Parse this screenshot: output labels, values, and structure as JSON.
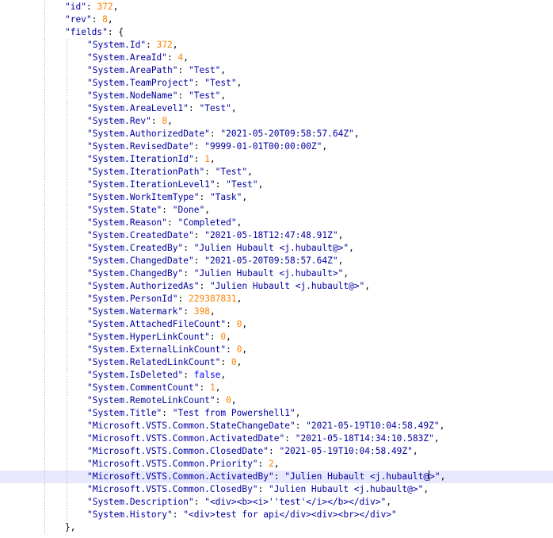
{
  "editor": {
    "active_line": 37,
    "caret_after": "Julien Hubault <j.hubault@",
    "colors": {
      "key_string": "#0000a0",
      "number": "#ff8000",
      "boolean": "#0000ff",
      "punctuation": "#000000",
      "active_line_bg": "#e8e8ff",
      "indent_guide": "#c8c8c8"
    },
    "lines": [
      {
        "indent": 0,
        "tokens": [
          {
            "t": "k",
            "v": "\"id\""
          },
          {
            "t": "p",
            "v": ": "
          },
          {
            "t": "n",
            "v": "372"
          },
          {
            "t": "p",
            "v": ","
          }
        ]
      },
      {
        "indent": 0,
        "tokens": [
          {
            "t": "k",
            "v": "\"rev\""
          },
          {
            "t": "p",
            "v": ": "
          },
          {
            "t": "n",
            "v": "8"
          },
          {
            "t": "p",
            "v": ","
          }
        ]
      },
      {
        "indent": 0,
        "tokens": [
          {
            "t": "k",
            "v": "\"fields\""
          },
          {
            "t": "p",
            "v": ": {"
          }
        ]
      },
      {
        "indent": 1,
        "tokens": [
          {
            "t": "k",
            "v": "\"System.Id\""
          },
          {
            "t": "p",
            "v": ": "
          },
          {
            "t": "n",
            "v": "372"
          },
          {
            "t": "p",
            "v": ","
          }
        ]
      },
      {
        "indent": 1,
        "tokens": [
          {
            "t": "k",
            "v": "\"System.AreaId\""
          },
          {
            "t": "p",
            "v": ": "
          },
          {
            "t": "n",
            "v": "4"
          },
          {
            "t": "p",
            "v": ","
          }
        ]
      },
      {
        "indent": 1,
        "tokens": [
          {
            "t": "k",
            "v": "\"System.AreaPath\""
          },
          {
            "t": "p",
            "v": ": "
          },
          {
            "t": "k",
            "v": "\"Test\""
          },
          {
            "t": "p",
            "v": ","
          }
        ]
      },
      {
        "indent": 1,
        "tokens": [
          {
            "t": "k",
            "v": "\"System.TeamProject\""
          },
          {
            "t": "p",
            "v": ": "
          },
          {
            "t": "k",
            "v": "\"Test\""
          },
          {
            "t": "p",
            "v": ","
          }
        ]
      },
      {
        "indent": 1,
        "tokens": [
          {
            "t": "k",
            "v": "\"System.NodeName\""
          },
          {
            "t": "p",
            "v": ": "
          },
          {
            "t": "k",
            "v": "\"Test\""
          },
          {
            "t": "p",
            "v": ","
          }
        ]
      },
      {
        "indent": 1,
        "tokens": [
          {
            "t": "k",
            "v": "\"System.AreaLevel1\""
          },
          {
            "t": "p",
            "v": ": "
          },
          {
            "t": "k",
            "v": "\"Test\""
          },
          {
            "t": "p",
            "v": ","
          }
        ]
      },
      {
        "indent": 1,
        "tokens": [
          {
            "t": "k",
            "v": "\"System.Rev\""
          },
          {
            "t": "p",
            "v": ": "
          },
          {
            "t": "n",
            "v": "8"
          },
          {
            "t": "p",
            "v": ","
          }
        ]
      },
      {
        "indent": 1,
        "tokens": [
          {
            "t": "k",
            "v": "\"System.AuthorizedDate\""
          },
          {
            "t": "p",
            "v": ": "
          },
          {
            "t": "k",
            "v": "\"2021-05-20T09:58:57.64Z\""
          },
          {
            "t": "p",
            "v": ","
          }
        ]
      },
      {
        "indent": 1,
        "tokens": [
          {
            "t": "k",
            "v": "\"System.RevisedDate\""
          },
          {
            "t": "p",
            "v": ": "
          },
          {
            "t": "k",
            "v": "\"9999-01-01T00:00:00Z\""
          },
          {
            "t": "p",
            "v": ","
          }
        ]
      },
      {
        "indent": 1,
        "tokens": [
          {
            "t": "k",
            "v": "\"System.IterationId\""
          },
          {
            "t": "p",
            "v": ": "
          },
          {
            "t": "n",
            "v": "1"
          },
          {
            "t": "p",
            "v": ","
          }
        ]
      },
      {
        "indent": 1,
        "tokens": [
          {
            "t": "k",
            "v": "\"System.IterationPath\""
          },
          {
            "t": "p",
            "v": ": "
          },
          {
            "t": "k",
            "v": "\"Test\""
          },
          {
            "t": "p",
            "v": ","
          }
        ]
      },
      {
        "indent": 1,
        "tokens": [
          {
            "t": "k",
            "v": "\"System.IterationLevel1\""
          },
          {
            "t": "p",
            "v": ": "
          },
          {
            "t": "k",
            "v": "\"Test\""
          },
          {
            "t": "p",
            "v": ","
          }
        ]
      },
      {
        "indent": 1,
        "tokens": [
          {
            "t": "k",
            "v": "\"System.WorkItemType\""
          },
          {
            "t": "p",
            "v": ": "
          },
          {
            "t": "k",
            "v": "\"Task\""
          },
          {
            "t": "p",
            "v": ","
          }
        ]
      },
      {
        "indent": 1,
        "tokens": [
          {
            "t": "k",
            "v": "\"System.State\""
          },
          {
            "t": "p",
            "v": ": "
          },
          {
            "t": "k",
            "v": "\"Done\""
          },
          {
            "t": "p",
            "v": ","
          }
        ]
      },
      {
        "indent": 1,
        "tokens": [
          {
            "t": "k",
            "v": "\"System.Reason\""
          },
          {
            "t": "p",
            "v": ": "
          },
          {
            "t": "k",
            "v": "\"Completed\""
          },
          {
            "t": "p",
            "v": ","
          }
        ]
      },
      {
        "indent": 1,
        "tokens": [
          {
            "t": "k",
            "v": "\"System.CreatedDate\""
          },
          {
            "t": "p",
            "v": ": "
          },
          {
            "t": "k",
            "v": "\"2021-05-18T12:47:48.91Z\""
          },
          {
            "t": "p",
            "v": ","
          }
        ]
      },
      {
        "indent": 1,
        "tokens": [
          {
            "t": "k",
            "v": "\"System.CreatedBy\""
          },
          {
            "t": "p",
            "v": ": "
          },
          {
            "t": "k",
            "v": "\"Julien Hubault <j.hubault@>\""
          },
          {
            "t": "p",
            "v": ","
          }
        ]
      },
      {
        "indent": 1,
        "tokens": [
          {
            "t": "k",
            "v": "\"System.ChangedDate\""
          },
          {
            "t": "p",
            "v": ": "
          },
          {
            "t": "k",
            "v": "\"2021-05-20T09:58:57.64Z\""
          },
          {
            "t": "p",
            "v": ","
          }
        ]
      },
      {
        "indent": 1,
        "tokens": [
          {
            "t": "k",
            "v": "\"System.ChangedBy\""
          },
          {
            "t": "p",
            "v": ": "
          },
          {
            "t": "k",
            "v": "\"Julien Hubault <j.hubault>\""
          },
          {
            "t": "p",
            "v": ","
          }
        ]
      },
      {
        "indent": 1,
        "tokens": [
          {
            "t": "k",
            "v": "\"System.AuthorizedAs\""
          },
          {
            "t": "p",
            "v": ": "
          },
          {
            "t": "k",
            "v": "\"Julien Hubault <j.hubault@>\""
          },
          {
            "t": "p",
            "v": ","
          }
        ]
      },
      {
        "indent": 1,
        "tokens": [
          {
            "t": "k",
            "v": "\"System.PersonId\""
          },
          {
            "t": "p",
            "v": ": "
          },
          {
            "t": "n",
            "v": "229387831"
          },
          {
            "t": "p",
            "v": ","
          }
        ]
      },
      {
        "indent": 1,
        "tokens": [
          {
            "t": "k",
            "v": "\"System.Watermark\""
          },
          {
            "t": "p",
            "v": ": "
          },
          {
            "t": "n",
            "v": "398"
          },
          {
            "t": "p",
            "v": ","
          }
        ]
      },
      {
        "indent": 1,
        "tokens": [
          {
            "t": "k",
            "v": "\"System.AttachedFileCount\""
          },
          {
            "t": "p",
            "v": ": "
          },
          {
            "t": "n",
            "v": "0"
          },
          {
            "t": "p",
            "v": ","
          }
        ]
      },
      {
        "indent": 1,
        "tokens": [
          {
            "t": "k",
            "v": "\"System.HyperLinkCount\""
          },
          {
            "t": "p",
            "v": ": "
          },
          {
            "t": "n",
            "v": "0"
          },
          {
            "t": "p",
            "v": ","
          }
        ]
      },
      {
        "indent": 1,
        "tokens": [
          {
            "t": "k",
            "v": "\"System.ExternalLinkCount\""
          },
          {
            "t": "p",
            "v": ": "
          },
          {
            "t": "n",
            "v": "0"
          },
          {
            "t": "p",
            "v": ","
          }
        ]
      },
      {
        "indent": 1,
        "tokens": [
          {
            "t": "k",
            "v": "\"System.RelatedLinkCount\""
          },
          {
            "t": "p",
            "v": ": "
          },
          {
            "t": "n",
            "v": "0"
          },
          {
            "t": "p",
            "v": ","
          }
        ]
      },
      {
        "indent": 1,
        "tokens": [
          {
            "t": "k",
            "v": "\"System.IsDeleted\""
          },
          {
            "t": "p",
            "v": ": "
          },
          {
            "t": "b",
            "v": "false"
          },
          {
            "t": "p",
            "v": ","
          }
        ]
      },
      {
        "indent": 1,
        "tokens": [
          {
            "t": "k",
            "v": "\"System.CommentCount\""
          },
          {
            "t": "p",
            "v": ": "
          },
          {
            "t": "n",
            "v": "1"
          },
          {
            "t": "p",
            "v": ","
          }
        ]
      },
      {
        "indent": 1,
        "tokens": [
          {
            "t": "k",
            "v": "\"System.RemoteLinkCount\""
          },
          {
            "t": "p",
            "v": ": "
          },
          {
            "t": "n",
            "v": "0"
          },
          {
            "t": "p",
            "v": ","
          }
        ]
      },
      {
        "indent": 1,
        "tokens": [
          {
            "t": "k",
            "v": "\"System.Title\""
          },
          {
            "t": "p",
            "v": ": "
          },
          {
            "t": "k",
            "v": "\"Test from Powershell1\""
          },
          {
            "t": "p",
            "v": ","
          }
        ]
      },
      {
        "indent": 1,
        "tokens": [
          {
            "t": "k",
            "v": "\"Microsoft.VSTS.Common.StateChangeDate\""
          },
          {
            "t": "p",
            "v": ": "
          },
          {
            "t": "k",
            "v": "\"2021-05-19T10:04:58.49Z\""
          },
          {
            "t": "p",
            "v": ","
          }
        ]
      },
      {
        "indent": 1,
        "tokens": [
          {
            "t": "k",
            "v": "\"Microsoft.VSTS.Common.ActivatedDate\""
          },
          {
            "t": "p",
            "v": ": "
          },
          {
            "t": "k",
            "v": "\"2021-05-18T14:34:10.583Z\""
          },
          {
            "t": "p",
            "v": ","
          }
        ]
      },
      {
        "indent": 1,
        "tokens": [
          {
            "t": "k",
            "v": "\"Microsoft.VSTS.Common.ClosedDate\""
          },
          {
            "t": "p",
            "v": ": "
          },
          {
            "t": "k",
            "v": "\"2021-05-19T10:04:58.49Z\""
          },
          {
            "t": "p",
            "v": ","
          }
        ]
      },
      {
        "indent": 1,
        "tokens": [
          {
            "t": "k",
            "v": "\"Microsoft.VSTS.Common.Priority\""
          },
          {
            "t": "p",
            "v": ": "
          },
          {
            "t": "n",
            "v": "2"
          },
          {
            "t": "p",
            "v": ","
          }
        ]
      },
      {
        "indent": 1,
        "tokens": [
          {
            "t": "k",
            "v": "\"Microsoft.VSTS.Common.ActivatedBy\""
          },
          {
            "t": "p",
            "v": ": "
          },
          {
            "t": "k",
            "v": "\"Julien Hubault <j.hubault@"
          },
          {
            "t": "caret",
            "v": ""
          },
          {
            "t": "k",
            "v": ">\""
          },
          {
            "t": "p",
            "v": ","
          }
        ]
      },
      {
        "indent": 1,
        "tokens": [
          {
            "t": "k",
            "v": "\"Microsoft.VSTS.Common.ClosedBy\""
          },
          {
            "t": "p",
            "v": ": "
          },
          {
            "t": "k",
            "v": "\"Julien Hubault <j.hubault@>\""
          },
          {
            "t": "p",
            "v": ","
          }
        ]
      },
      {
        "indent": 1,
        "tokens": [
          {
            "t": "k",
            "v": "\"System.Description\""
          },
          {
            "t": "p",
            "v": ": "
          },
          {
            "t": "k",
            "v": "\"<div><b><i>''test'</i></b></div>\""
          },
          {
            "t": "p",
            "v": ","
          }
        ]
      },
      {
        "indent": 1,
        "tokens": [
          {
            "t": "k",
            "v": "\"System.History\""
          },
          {
            "t": "p",
            "v": ": "
          },
          {
            "t": "k",
            "v": "\"<div>test for api</div><div><br></div>\""
          }
        ]
      },
      {
        "indent": 0,
        "tokens": [
          {
            "t": "p",
            "v": "},"
          }
        ]
      }
    ]
  }
}
